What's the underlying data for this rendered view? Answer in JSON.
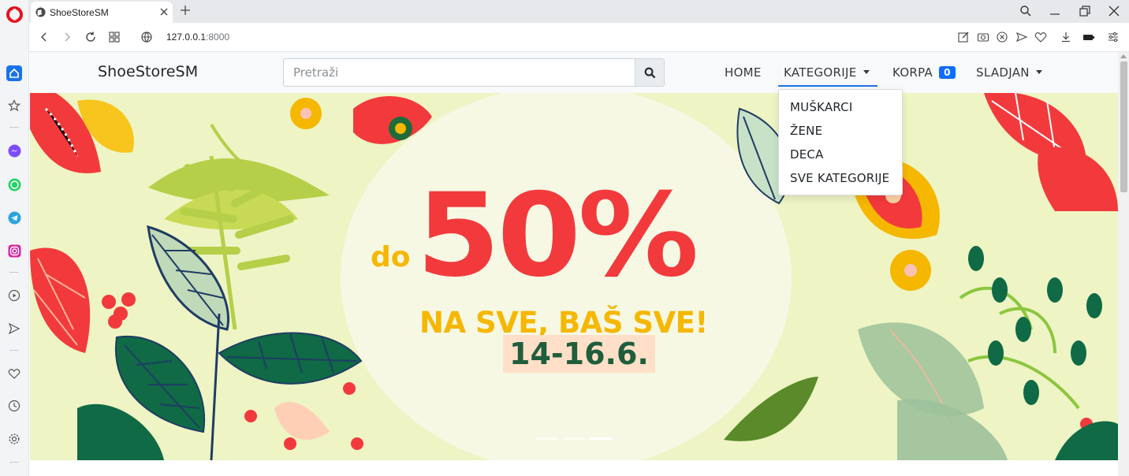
{
  "browser": {
    "tab_title": "ShoeStoreSM",
    "url_host": "127.0.0.1",
    "url_port": ":8000"
  },
  "navbar": {
    "brand": "ShoeStoreSM",
    "search_placeholder": "Pretraži",
    "home": "HOME",
    "categories": "KATEGORIJE",
    "cart": "KORPA",
    "cart_count": "0",
    "user": "SLADJAN"
  },
  "dropdown": {
    "items": [
      "MUŠKARCI",
      "ŽENE",
      "DECA",
      "SVE KATEGORIJE"
    ]
  },
  "banner": {
    "prefix": "do",
    "discount": "50%",
    "headline": "NA SVE, BAŠ SVE!",
    "dates": "14-16.6.",
    "colors": {
      "background": "#eef4c4",
      "accent_red": "#f23a3c",
      "accent_yellow": "#f5b700",
      "accent_green": "#1f5e3c"
    }
  }
}
